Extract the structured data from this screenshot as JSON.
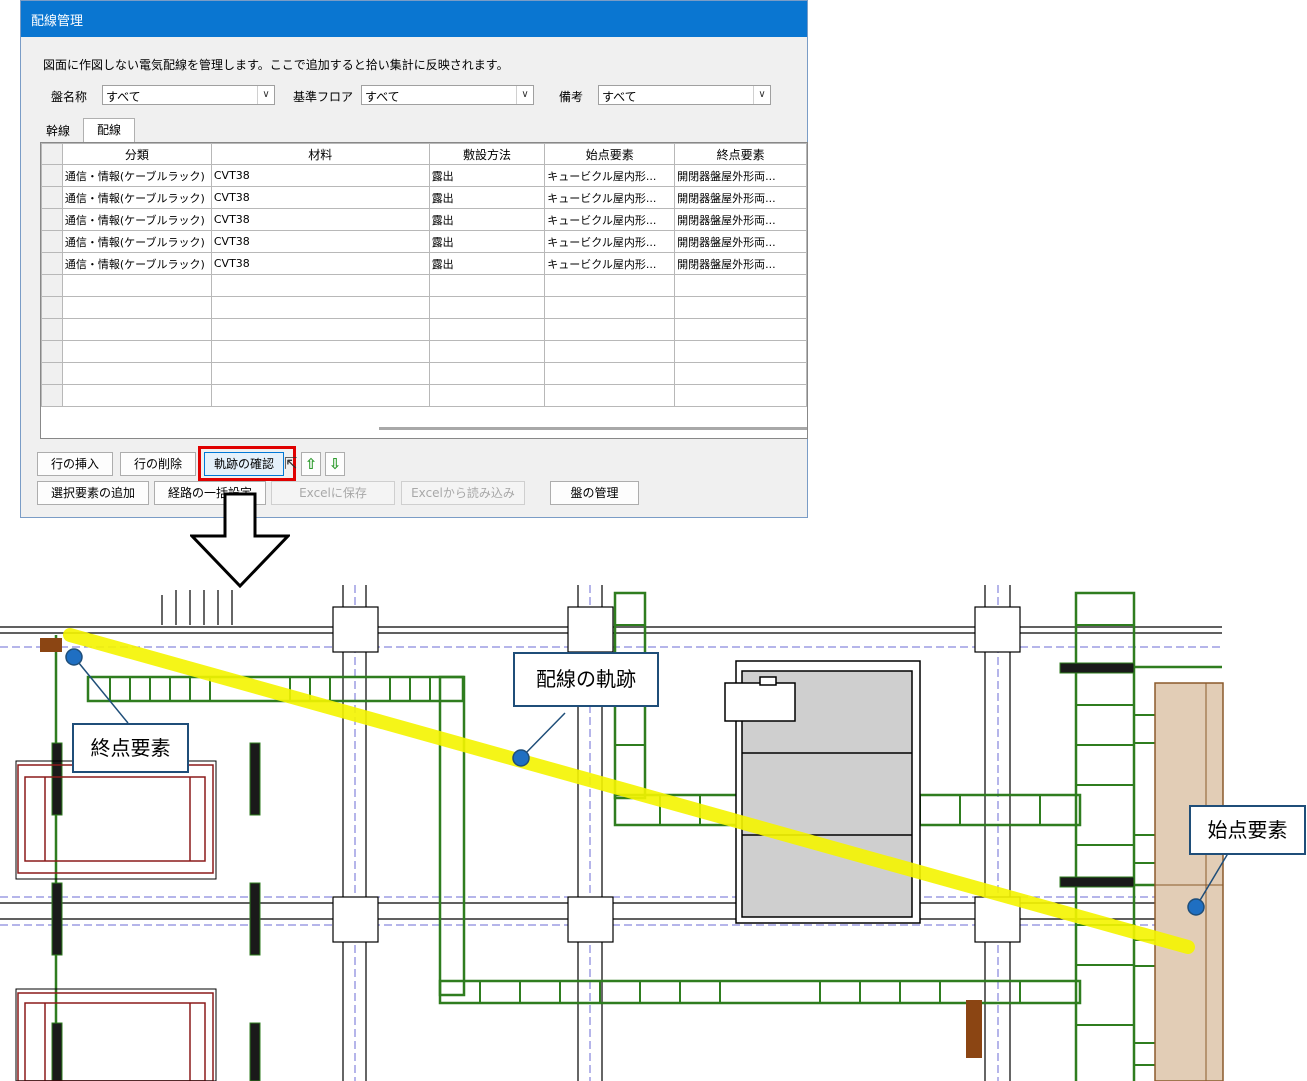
{
  "dialog": {
    "title": "配線管理",
    "description": "図面に作図しない電気配線を管理します。ここで追加すると拾い集計に反映されます。",
    "filters": [
      {
        "label": "盤名称",
        "value": "すべて"
      },
      {
        "label": "基準フロア",
        "value": "すべて"
      },
      {
        "label": "備考",
        "value": "すべて"
      }
    ],
    "tabs": [
      "幹線",
      "配線"
    ],
    "columns": [
      "分類",
      "材料",
      "敷設方法",
      "始点要素",
      "終点要素"
    ],
    "rows": [
      [
        "通信・情報(ケーブルラック)",
        "CVT38",
        "露出",
        "キュービクル屋内形...",
        "開閉器盤屋外形両..."
      ],
      [
        "通信・情報(ケーブルラック)",
        "CVT38",
        "露出",
        "キュービクル屋内形...",
        "開閉器盤屋外形両..."
      ],
      [
        "通信・情報(ケーブルラック)",
        "CVT38",
        "露出",
        "キュービクル屋内形...",
        "開閉器盤屋外形両..."
      ],
      [
        "通信・情報(ケーブルラック)",
        "CVT38",
        "露出",
        "キュービクル屋内形...",
        "開閉器盤屋外形両..."
      ],
      [
        "通信・情報(ケーブルラック)",
        "CVT38",
        "露出",
        "キュービクル屋内形...",
        "開閉器盤屋外形両..."
      ]
    ],
    "buttons": {
      "insert_row": "行の挿入",
      "delete_row": "行の削除",
      "check_path": "軌跡の確認",
      "up_arrow": "⇧",
      "down_arrow": "⇩",
      "add_selected": "選択要素の追加",
      "bulk_route": "経路の一括設定",
      "save_excel": "Excelに保存",
      "load_excel": "Excelから読み込み",
      "manage_panel": "盤の管理"
    }
  },
  "callouts": {
    "path": "配線の軌跡",
    "end": "終点要素",
    "start": "始点要素"
  },
  "colors": {
    "titlebar": "#0a76d1",
    "highlight": "#e00000",
    "path": "#f5f500",
    "rack": "#2f7d1f",
    "grid_line": "#6b6bd6",
    "callout_border": "#1f4e79"
  }
}
